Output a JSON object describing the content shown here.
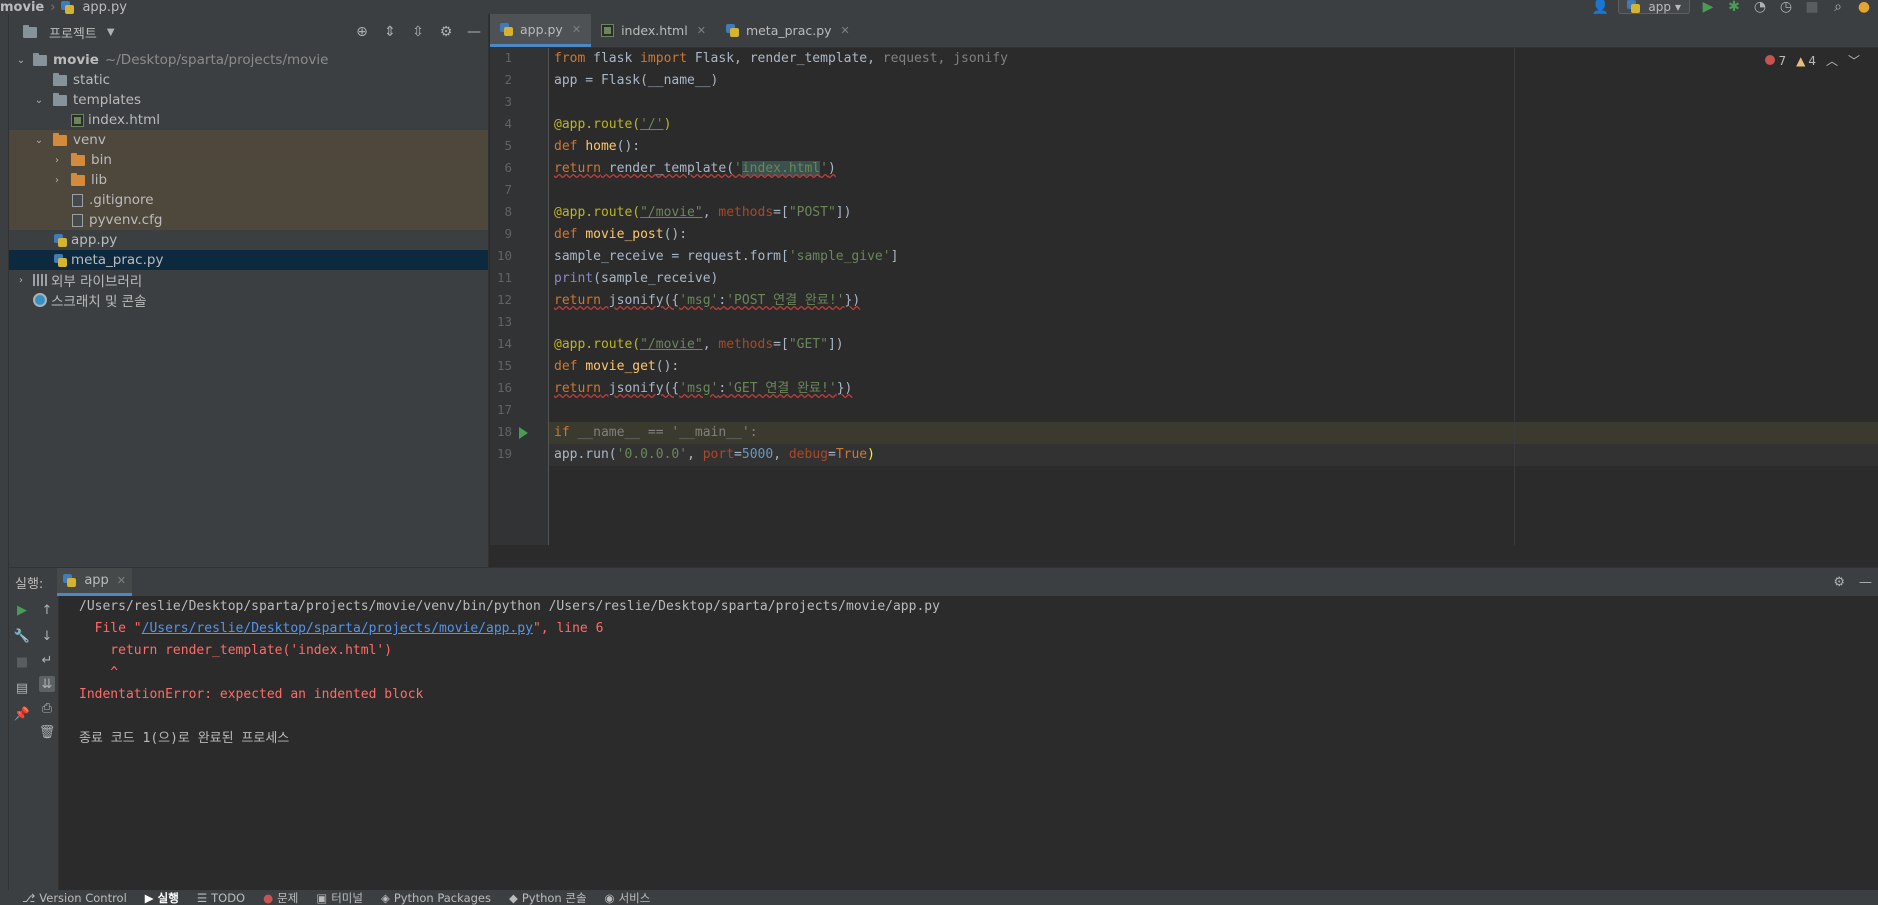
{
  "navbar": {
    "project": "movie",
    "file": "app.py",
    "run_config": "app"
  },
  "project_panel": {
    "title": "프로젝트",
    "tree": [
      {
        "label": "movie",
        "path": "~/Desktop/sparta/projects/movie",
        "type": "folder"
      },
      {
        "label": "static",
        "type": "folder"
      },
      {
        "label": "templates",
        "type": "folder"
      },
      {
        "label": "index.html",
        "type": "html"
      },
      {
        "label": "venv",
        "type": "folder-orange"
      },
      {
        "label": "bin",
        "type": "folder-orange"
      },
      {
        "label": "lib",
        "type": "folder-orange"
      },
      {
        "label": ".gitignore",
        "type": "file"
      },
      {
        "label": "pyvenv.cfg",
        "type": "file"
      },
      {
        "label": "app.py",
        "type": "python"
      },
      {
        "label": "meta_prac.py",
        "type": "python"
      },
      {
        "label": "외부 라이브러리",
        "type": "library"
      },
      {
        "label": "스크래치 및 콘솔",
        "type": "scratch"
      }
    ]
  },
  "editor_tabs": [
    {
      "label": "app.py",
      "active": true
    },
    {
      "label": "index.html",
      "active": false
    },
    {
      "label": "meta_prac.py",
      "active": false
    }
  ],
  "inspections": {
    "errors": "7",
    "warnings": "4"
  },
  "code": {
    "line_numbers": [
      "1",
      "2",
      "3",
      "4",
      "5",
      "6",
      "7",
      "8",
      "9",
      "10",
      "11",
      "12",
      "13",
      "14",
      "15",
      "16",
      "17",
      "18",
      "19"
    ],
    "l1": {
      "a": "from",
      "b": " flask ",
      "c": "import",
      "d": " Flask, render_template, ",
      "e": "request, jsonify"
    },
    "l2": "app = Flask(__name__)",
    "l4": {
      "a": "@app.route(",
      "b": "'/'",
      "c": ")"
    },
    "l5": {
      "a": "def",
      "b": "home",
      "c": "():"
    },
    "l6": {
      "a": "return",
      "b": " render_template(",
      "c": "'",
      "d": "index.html",
      "e": "'",
      "f": ")"
    },
    "l8": {
      "a": "@app.route(",
      "b": "\"/movie\"",
      "c": ", ",
      "d": "methods",
      "e": "=[",
      "f": "\"POST\"",
      "g": "])"
    },
    "l9": {
      "a": "def",
      "b": "movie_post",
      "c": "():"
    },
    "l10": {
      "a": "sample_receive = request.form[",
      "b": "'sample_give'",
      "c": "]"
    },
    "l11": {
      "a": "print",
      "b": "(sample_receive)"
    },
    "l12": {
      "a": "return",
      "b": " jsonify({",
      "c": "'msg'",
      "d": ":",
      "e": "'POST 연결 완료!'",
      "f": "})"
    },
    "l14": {
      "a": "@app.route(",
      "b": "\"/movie\"",
      "c": ", ",
      "d": "methods",
      "e": "=[",
      "f": "\"GET\"",
      "g": "])"
    },
    "l15": {
      "a": "def",
      "b": "movie_get",
      "c": "():"
    },
    "l16": {
      "a": "return",
      "b": " jsonify({",
      "c": "'msg'",
      "d": ":",
      "e": "'GET 연결 완료!'",
      "f": "})"
    },
    "l18": {
      "a": "if",
      "b": " __name__ == ",
      "c": "'__main__'",
      "d": ":"
    },
    "l19": {
      "a": "app.run(",
      "b": "'0.0.0.0'",
      "c": ", ",
      "d": "port",
      "e": "=",
      "f": "5000",
      "g": ", ",
      "h": "debug",
      "i": "=",
      "j": "True",
      "k": ")"
    }
  },
  "run_panel": {
    "label": "실행:",
    "tab": "app",
    "console": {
      "cmd": "/Users/reslie/Desktop/sparta/projects/movie/venv/bin/python /Users/reslie/Desktop/sparta/projects/movie/app.py",
      "file_prefix": "  File \"",
      "file_link": "/Users/reslie/Desktop/sparta/projects/movie/app.py",
      "file_suffix": "\", line 6",
      "code": "    return render_template('index.html')",
      "caret": "    ^",
      "error": "IndentationError: expected an indented block",
      "exit": "종료 코드 1(으)로 완료된 프로세스"
    }
  },
  "statusbar": {
    "items": [
      "Version Control",
      "실행",
      "TODO",
      "문제",
      "터미널",
      "Python Packages",
      "Python 콘솔",
      "서비스"
    ]
  }
}
